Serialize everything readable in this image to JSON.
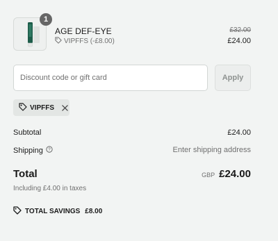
{
  "product": {
    "quantity": "1",
    "name": "AGE DEF-EYE",
    "discount_label": "VIPFFS (-£8.00)",
    "original_price": "£32.00",
    "price": "£24.00",
    "thumbnail_colors": {
      "tube": "#1d5c4a",
      "cap": "#e8e8e8"
    }
  },
  "discount": {
    "placeholder": "Discount code or gift card",
    "value": "",
    "apply_label": "Apply"
  },
  "applied_code": {
    "code": "VIPFFS"
  },
  "summary": {
    "subtotal_label": "Subtotal",
    "subtotal_value": "£24.00",
    "shipping_label": "Shipping",
    "shipping_value": "Enter shipping address",
    "total_label": "Total",
    "currency": "GBP",
    "total_value": "£24.00",
    "taxes_note": "Including £4.00 in taxes",
    "savings_label": "TOTAL SAVINGS",
    "savings_value": "£8.00"
  }
}
